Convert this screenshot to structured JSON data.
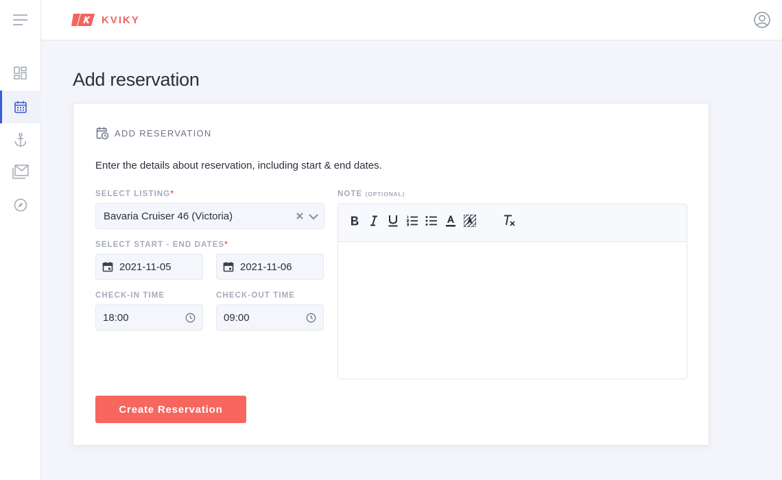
{
  "app": {
    "brand": "KVIKY",
    "brand_color": "#f2645f",
    "accent": "#3a5bd9"
  },
  "sidebar": {
    "items": [
      {
        "icon": "dashboard-icon",
        "active": false
      },
      {
        "icon": "calendar-icon",
        "active": true
      },
      {
        "icon": "anchor-icon",
        "active": false
      },
      {
        "icon": "mail-icon",
        "active": false
      },
      {
        "icon": "compass-icon",
        "active": false
      }
    ]
  },
  "page": {
    "title": "Add reservation"
  },
  "card": {
    "heading": "ADD RESERVATION",
    "description": "Enter the details about reservation, including start & end dates.",
    "listing": {
      "label": "SELECT LISTING",
      "required": "*",
      "value": "Bavaria Cruiser 46 (Victoria)"
    },
    "dates": {
      "label": "SELECT START - END DATES",
      "required": "*",
      "start": "2021-11-05",
      "end": "2021-11-06"
    },
    "checkin": {
      "label": "CHECK-IN TIME",
      "value": "18:00"
    },
    "checkout": {
      "label": "CHECK-OUT TIME",
      "value": "09:00"
    },
    "note": {
      "label": "NOTE",
      "optional": "(OPTIONAL)",
      "value": ""
    },
    "submit_label": "Create Reservation",
    "submit_color": "#f7665f"
  }
}
